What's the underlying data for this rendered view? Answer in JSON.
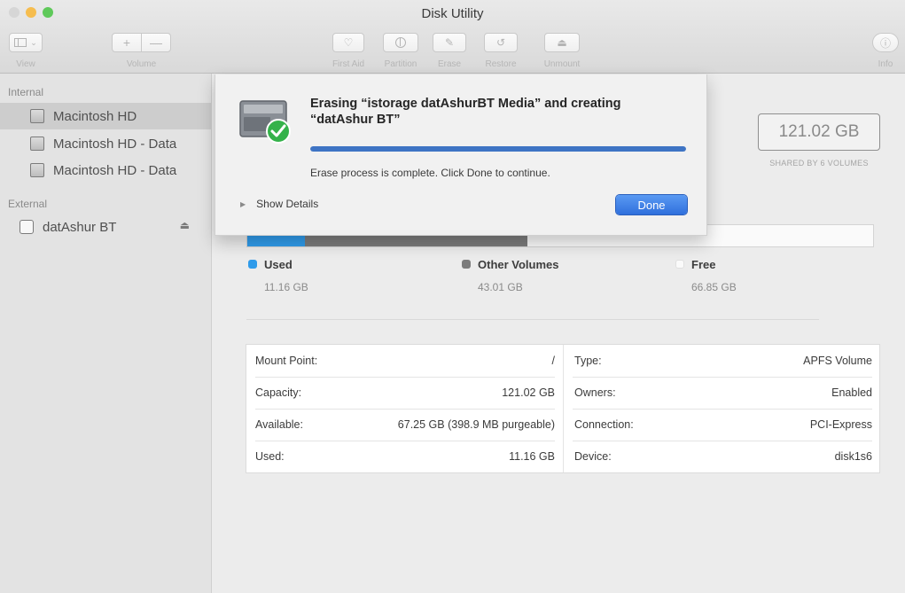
{
  "window": {
    "title": "Disk Utility"
  },
  "toolbar": {
    "view_label": "View",
    "volume_label": "Volume",
    "add_glyph": "+",
    "remove_glyph": "—",
    "first_aid_label": "First Aid",
    "partition_label": "Partition",
    "erase_label": "Erase",
    "restore_label": "Restore",
    "unmount_label": "Unmount",
    "info_label": "Info"
  },
  "sidebar": {
    "internal_header": "Internal",
    "external_header": "External",
    "internal_items": [
      {
        "label": "Macintosh HD",
        "selected": true
      },
      {
        "label": "Macintosh HD - Data",
        "selected": false
      },
      {
        "label": "Macintosh HD - Data",
        "selected": false
      }
    ],
    "external_items": [
      {
        "label": "datAshur BT",
        "eject_glyph": "⏏"
      }
    ]
  },
  "capacity": {
    "value": "121.02 GB",
    "subtitle": "SHARED BY 6 VOLUMES"
  },
  "usage": {
    "used_fraction": 0.0922,
    "other_fraction": 0.3554,
    "colors": {
      "used": "#2f9bea",
      "other": "#7c7c7c",
      "free": "#fafafa"
    },
    "legend": [
      {
        "title": "Used",
        "value": "11.16 GB"
      },
      {
        "title": "Other Volumes",
        "value": "43.01 GB"
      },
      {
        "title": "Free",
        "value": "66.85 GB"
      }
    ]
  },
  "info": {
    "left": [
      {
        "key": "Mount Point:",
        "value": "/"
      },
      {
        "key": "Capacity:",
        "value": "121.02 GB"
      },
      {
        "key": "Available:",
        "value": "67.25 GB (398.9 MB purgeable)"
      },
      {
        "key": "Used:",
        "value": "11.16 GB"
      }
    ],
    "right": [
      {
        "key": "Type:",
        "value": "APFS Volume"
      },
      {
        "key": "Owners:",
        "value": "Enabled"
      },
      {
        "key": "Connection:",
        "value": "PCI-Express"
      },
      {
        "key": "Device:",
        "value": "disk1s6"
      }
    ]
  },
  "sheet": {
    "title": "Erasing “istorage datAshurBT Media” and creating “datAshur BT”",
    "progress": 1.0,
    "message": "Erase process is complete. Click Done to continue.",
    "show_details_label": "Show Details",
    "done_label": "Done"
  }
}
